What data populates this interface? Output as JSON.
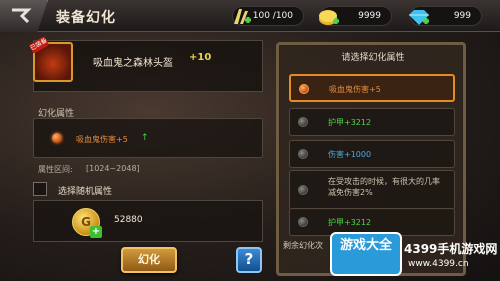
{
  "header": {
    "title": "装备幻化",
    "resources": {
      "stamina": {
        "value": "100 /100",
        "icon": "stamina-icon"
      },
      "gold": {
        "value": "9999",
        "icon": "gold-coin-icon"
      },
      "gem": {
        "value": "999",
        "icon": "diamond-icon"
      }
    }
  },
  "item": {
    "badge": "已装备",
    "name": "吸血鬼之森林头盔",
    "level": "+10"
  },
  "attribute": {
    "label": "幻化属性",
    "text": "吸血鬼伤害+5",
    "arrow": "↑",
    "range_label": "属性区间:",
    "range_value": "[1024~2048]"
  },
  "random": {
    "label": "选择随机属性"
  },
  "cost": {
    "coin_glyph": "G",
    "plus": "+",
    "value": "52880"
  },
  "buttons": {
    "magic": "幻化",
    "help": "?"
  },
  "right_panel": {
    "title": "请选择幻化属性",
    "options": [
      {
        "text": "吸血鬼伤害+5",
        "color": "#e58b3f",
        "selected": true
      },
      {
        "text": "护甲+3212",
        "color": "#4fd34a",
        "selected": false
      },
      {
        "text": "伤害+1000",
        "color": "#4aa8e8",
        "selected": false
      },
      {
        "text": "在受攻击的时候，有很大的几率减免伤害2%",
        "color": "#cfc3ae",
        "selected": false
      },
      {
        "text": "护甲+3212",
        "color": "#4fd34a",
        "selected": false
      }
    ],
    "remaining": "剩余幻化次"
  },
  "watermark": {
    "logo": "游戏大全",
    "text": "4399手机游戏网",
    "url": "www.4399.cn"
  }
}
